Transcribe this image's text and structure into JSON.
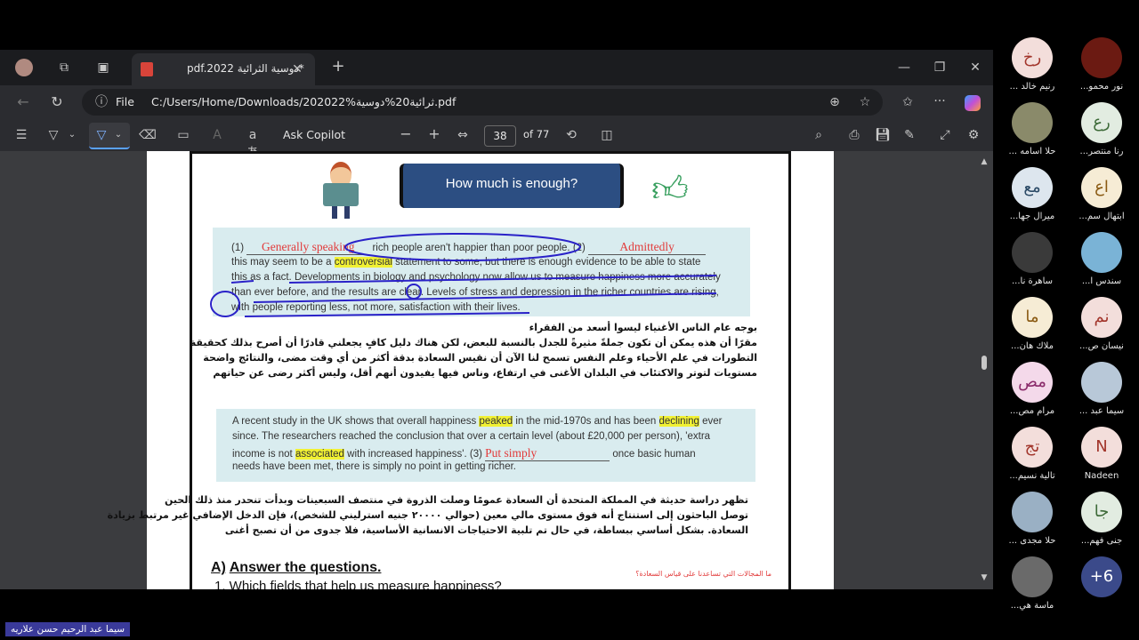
{
  "browser": {
    "tab_title": "pdf.2022 دوسية الثرائية*",
    "url_prefix": "File",
    "url": "C:/Users/Home/Downloads/202022%ثرائية20%دوسية.pdf"
  },
  "pdf_toolbar": {
    "ask_copilot": "Ask Copilot",
    "page_number": "38",
    "page_total": "of 77"
  },
  "document": {
    "banner_title": "How much is enough?",
    "para1": {
      "num1": "(1)",
      "blank1": "Generally speaking",
      "text1": "rich people aren't happier than poor people.",
      "num2": "(2)",
      "blank2": "Admittedly",
      "line2a": "this may seem to be a",
      "line2hl": "controversial",
      "line2b": "statement to some, but there is enough evidence to be able to state",
      "line3": "this as a fact. Developments in biology and psychology now allow us to measure happiness more accurately",
      "line4": "than ever before, and the results are clear. Levels of stress and depression in the richer countries are rising,",
      "line5": "with people reporting less, not more, satisfaction with their lives."
    },
    "arabic1": [
      "بوجه عام الناس الأغنياء ليسوا أسعد من الفقراء",
      "مقرًا أن هذه يمكن أن تكون جملةً مثيرةً للجدل بالنسبة للبعض، لكن هناك دليل كافٍ يجعلني قادرًا أن أصرح بذلك كحقيقة",
      "التطورات في علم الأحياء وعلم النفس تسمح لنا الآن أن نقيس السعادة بدقة أكثر من أي وقت مضى، والنتائج واضحة",
      "مستويات لتوتر والاكتئاب في البلدان الأغنى في ارتفاع، وناس فيها يفيدون أنهم أقل، وليس أكثر رضى عن حياتهم"
    ],
    "para2": {
      "l1a": "A recent study in the UK shows that overall happiness",
      "l1hl1": "peaked",
      "l1b": "in the mid-1970s and has been",
      "l1hl2": "declining",
      "l1c": "ever",
      "l2": "since. The researchers reached the conclusion that over a certain level (about £20,000 per person), 'extra",
      "l3a": "income is not",
      "l3hl": "associated",
      "l3b": "with increased happiness'. (3)",
      "blank3": "Put simply",
      "l3c": "once basic human",
      "l4": "needs have been met, there is simply no point in getting richer."
    },
    "arabic2": [
      "تظهر دراسة حديثة في المملكة المتحدة أن السعادة عمومًا وصلت الذروة في منتصف السبعينات وبدأت تنحدر منذ ذلك الحين",
      "توصل الباحثون إلى استنتاج أنه فوق مستوى مالي معين (حوالي ٢٠٠٠٠ جنيه استرليني للشخص)، فإن الدخل الإضافي غير مرتبط بزيادة",
      "السعادة. بشكل أساسي ببساطة، في حال تم تلبية الاحتياجات الانسانية الأساسية، فلا جدوى من أن تصبح أغنى"
    ],
    "section_letter": "A)",
    "section_title": "Answer the questions.",
    "q1": "1. Which fields that help us measure happiness?",
    "q1_ar": "ما المجالات التي تساعدنا على قياس السعادة؟"
  },
  "participants": [
    {
      "initials": "رخ",
      "name": "... رنيم خالد",
      "bg": "#f3dedb",
      "fg": "#a2352b"
    },
    {
      "initials": "",
      "name": "...نور محمو",
      "bg": "#6b1a12",
      "fg": "#fff"
    },
    {
      "initials": "",
      "name": "... حلا اسامه",
      "bg": "#8a8a6a",
      "fg": "#fff"
    },
    {
      "initials": "رع",
      "name": "...رنا منتصر",
      "bg": "#e2ece1",
      "fg": "#3d6a38"
    },
    {
      "initials": "مع",
      "name": "...ميرال جها",
      "bg": "#dde6ee",
      "fg": "#2b4a66"
    },
    {
      "initials": "اع",
      "name": "...ابتهال سم",
      "bg": "#f6ecd5",
      "fg": "#8a5a12"
    },
    {
      "initials": "",
      "name": "...ساهرة نا",
      "bg": "#3a3a3a",
      "fg": "#fff"
    },
    {
      "initials": "",
      "name": "...سندس ا",
      "bg": "#7ab3d6",
      "fg": "#fff"
    },
    {
      "initials": "ما",
      "name": "...ملاك هان",
      "bg": "#f6ecd5",
      "fg": "#8a5a12"
    },
    {
      "initials": "نم",
      "name": "...نيسان ص",
      "bg": "#f3dedb",
      "fg": "#a2352b"
    },
    {
      "initials": "مص",
      "name": "...مرام مص",
      "bg": "#f4d9ea",
      "fg": "#8a2a6a"
    },
    {
      "initials": "",
      "name": "... سيما عبد",
      "bg": "#b8c8d8",
      "fg": "#fff"
    },
    {
      "initials": "تج",
      "name": "...تالية نسيم",
      "bg": "#f3dedb",
      "fg": "#a2352b"
    },
    {
      "initials": "N",
      "name": "Nadeen",
      "bg": "#f3dedb",
      "fg": "#a2352b"
    },
    {
      "initials": "",
      "name": "... حلا مجدى",
      "bg": "#9ab0c4",
      "fg": "#fff"
    },
    {
      "initials": "جا",
      "name": "...جنى فهم",
      "bg": "#e2ece1",
      "fg": "#3d6a38"
    },
    {
      "initials": "",
      "name": "...ماسة هي",
      "bg": "#6a6a6a",
      "fg": "#fff"
    },
    {
      "initials": "+6",
      "name": "",
      "bg": "#3b4a8a",
      "fg": "#fff"
    }
  ],
  "speaker_tag": "سيما عبد الرحيم حسن علاريه",
  "colors": {
    "highlight": "#f1f133",
    "answer_red": "#e23b3b",
    "box_bg": "#d9ecef"
  }
}
